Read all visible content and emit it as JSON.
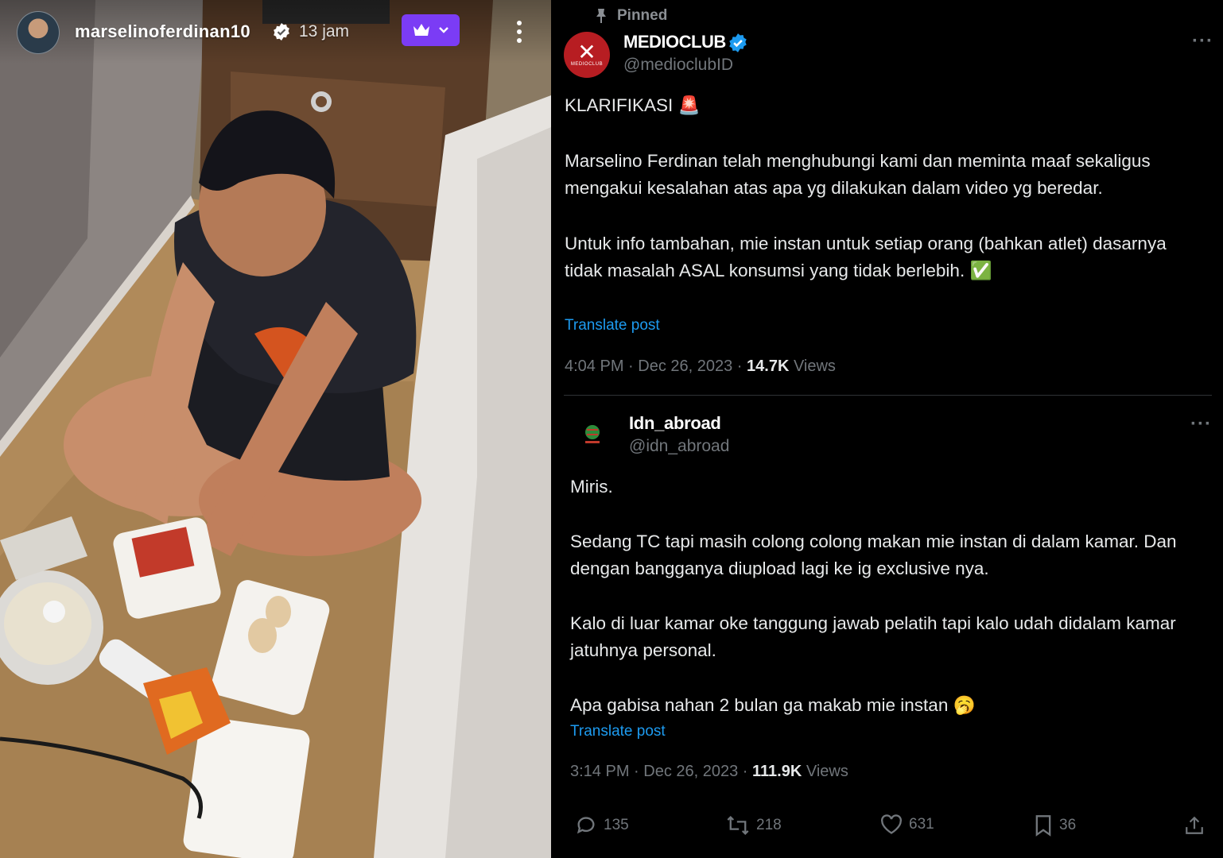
{
  "story": {
    "username": "marselinoferdinan10",
    "time": "13 jam"
  },
  "tweet1": {
    "pinned_label": "Pinned",
    "display_name": "MEDIOCLUB",
    "handle": "@medioclubID",
    "avatar_text": "MEDIOCLUB",
    "paragraphs": [
      "KLARIFIKASI 🚨",
      "Marselino Ferdinan telah menghubungi kami dan meminta maaf sekaligus mengakui kesalahan atas apa yg dilakukan dalam video yg beredar.",
      "Untuk info tambahan, mie instan untuk setiap orang (bahkan atlet) dasarnya tidak masalah ASAL konsumsi yang tidak berlebih. ✅"
    ],
    "translate": "Translate post",
    "timestamp": "4:04 PM · Dec 26, 2023 · ",
    "views_count": "14.7K",
    "views_label": " Views"
  },
  "tweet2": {
    "display_name": "Idn_abroad",
    "handle": "@idn_abroad",
    "paragraphs": [
      "Miris.",
      "Sedang TC tapi masih colong colong makan mie instan di dalam kamar. Dan dengan bangganya diupload lagi ke ig exclusive nya.",
      "Kalo di luar kamar oke tanggung jawab pelatih tapi kalo udah didalam kamar jatuhnya personal.",
      "Apa gabisa nahan 2 bulan ga makab mie instan 🥱"
    ],
    "translate": "Translate post",
    "timestamp": "3:14 PM · Dec 26, 2023 · ",
    "views_count": "111.9K",
    "views_label": " Views",
    "actions": {
      "replies": "135",
      "reposts": "218",
      "likes": "631",
      "bookmarks": "36"
    }
  },
  "colors": {
    "accent_link": "#1d9bf0",
    "verified": "#1d9bf0",
    "premium_button": "#7b3cf5",
    "medio_brand": "#b71d22"
  }
}
